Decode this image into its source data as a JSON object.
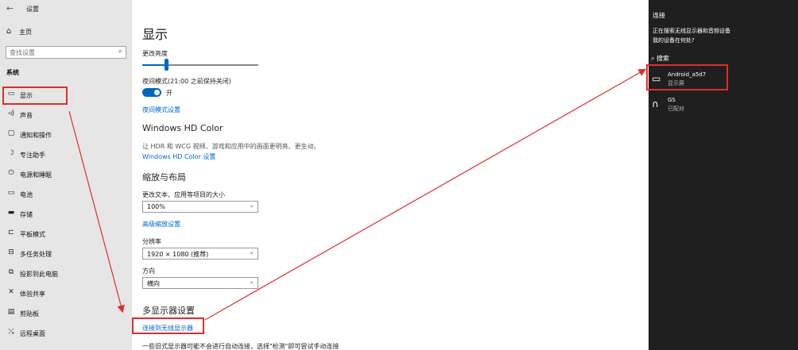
{
  "window": {
    "title": "设置",
    "back_icon": "back-arrow-icon"
  },
  "sidebar": {
    "home": {
      "icon": "home-icon",
      "label": "主页"
    },
    "search_placeholder": "查找设置",
    "section": "系统",
    "items": [
      {
        "icon": "monitor-icon",
        "label": "显示"
      },
      {
        "icon": "speaker-icon",
        "label": "声音"
      },
      {
        "icon": "notification-icon",
        "label": "通知和操作"
      },
      {
        "icon": "moon-icon",
        "label": "专注助手"
      },
      {
        "icon": "power-icon",
        "label": "电源和睡眠"
      },
      {
        "icon": "battery-icon",
        "label": "电池"
      },
      {
        "icon": "storage-icon",
        "label": "存储"
      },
      {
        "icon": "tablet-icon",
        "label": "平板模式"
      },
      {
        "icon": "multitask-icon",
        "label": "多任务处理"
      },
      {
        "icon": "project-icon",
        "label": "投影到此电脑"
      },
      {
        "icon": "shared-experience-icon",
        "label": "体验共享"
      },
      {
        "icon": "clipboard-icon",
        "label": "剪贴板"
      },
      {
        "icon": "remote-desktop-icon",
        "label": "远程桌面"
      }
    ]
  },
  "main": {
    "title": "显示",
    "brightness_label": "更改亮度",
    "brightness_level": 0.2,
    "night_mode_label": "夜间模式(21:00 之前保持关闭)",
    "night_toggle_state": "开",
    "night_settings_link": "夜间模式设置",
    "hdr": {
      "heading": "Windows HD Color",
      "desc": "让 HDR 和 WCG 视频、游戏和应用中的画面更明亮、更生动。",
      "link": "Windows HD Color 设置"
    },
    "scale": {
      "heading": "缩放与布局",
      "text_size_label": "更改文本、应用等项目的大小",
      "text_size_value": "100%",
      "advanced_link": "高级缩放设置",
      "resolution_label": "分辨率",
      "resolution_value": "1920 × 1080 (推荐)",
      "orientation_label": "方向",
      "orientation_value": "横向"
    },
    "multi": {
      "heading": "多显示器设置",
      "connect_link": "连接到无线显示器",
      "note": "一些旧式显示器可能不会进行自动连接，选择\"检测\"即可尝试手动连接"
    }
  },
  "connect_panel": {
    "title": "连接",
    "status": "正在搜索无线显示器和音频设备",
    "help_link": "我的设备在何处?",
    "search_label": "搜索",
    "devices": [
      {
        "icon": "monitor-icon",
        "name": "Android_a5d7",
        "sub": "显示屏"
      },
      {
        "icon": "headphones-icon",
        "name": "GS",
        "sub": "已配对"
      }
    ]
  },
  "colors": {
    "accent": "#0067c0",
    "highlight": "#e02c2c",
    "panel_bg": "#1f1f1f",
    "sidebar_bg": "#e6e6e6"
  }
}
